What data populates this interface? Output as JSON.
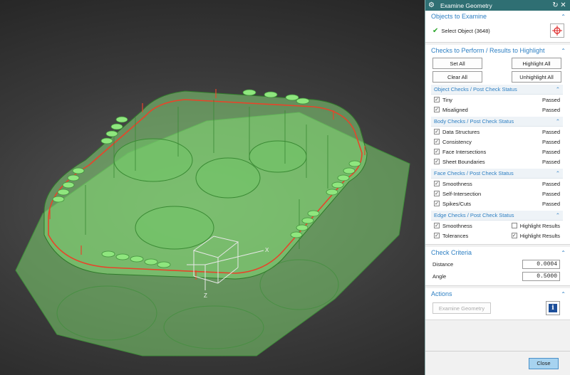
{
  "dialog": {
    "title": "Examine Geometry",
    "objects": {
      "heading": "Objects to Examine",
      "select_label": "Select Object (3648)"
    },
    "checks": {
      "heading": "Checks to Perform / Results to Highlight",
      "set_all": "Set All",
      "clear_all": "Clear All",
      "highlight_all": "Highlight All",
      "unhighlight_all": "Unhighlight All",
      "object_checks": {
        "heading": "Object Checks / Post Check Status",
        "items": [
          {
            "label": "Tiny",
            "status": "Passed"
          },
          {
            "label": "Misaligned",
            "status": "Passed"
          }
        ]
      },
      "body_checks": {
        "heading": "Body Checks / Post Check Status",
        "items": [
          {
            "label": "Data Structures",
            "status": "Passed"
          },
          {
            "label": "Consistency",
            "status": "Passed"
          },
          {
            "label": "Face Intersections",
            "status": "Passed"
          },
          {
            "label": "Sheet Boundaries",
            "status": "Passed"
          }
        ]
      },
      "face_checks": {
        "heading": "Face Checks / Post Check Status",
        "items": [
          {
            "label": "Smoothness",
            "status": "Passed"
          },
          {
            "label": "Self-Intersection",
            "status": "Passed"
          },
          {
            "label": "Spikes/Cuts",
            "status": "Passed"
          }
        ]
      },
      "edge_checks": {
        "heading": "Edge Checks / Post Check Status",
        "items": [
          {
            "label": "Smoothness",
            "highlight": "Highlight Results",
            "highlight_checked": false
          },
          {
            "label": "Tolerances",
            "highlight": "Highlight Results",
            "highlight_checked": true
          }
        ]
      }
    },
    "criteria": {
      "heading": "Check Criteria",
      "distance_label": "Distance",
      "distance_value": "0.0004",
      "angle_label": "Angle",
      "angle_value": "0.5000"
    },
    "actions": {
      "heading": "Actions",
      "examine_button": "Examine Geometry"
    },
    "close_button": "Close"
  },
  "viewport": {
    "axis_x": "X",
    "axis_z": "Z"
  },
  "colors": {
    "title_bar": "#2f6f73",
    "accent": "#2d7fc3",
    "part_fill": "#7ed36f",
    "edge_highlight": "#e8442a"
  }
}
